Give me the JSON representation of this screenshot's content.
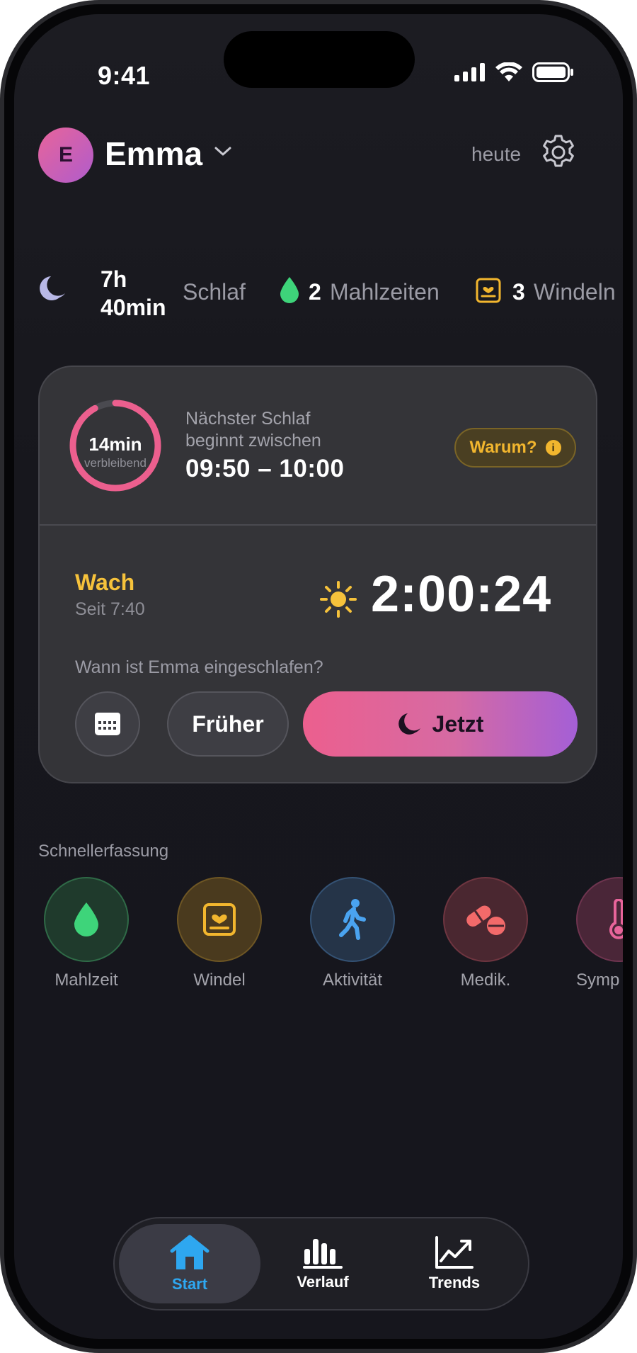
{
  "status_bar": {
    "time": "9:41"
  },
  "header": {
    "avatar_initial": "E",
    "profile_name": "Emma",
    "date_label": "heute"
  },
  "summary": {
    "sleep_value": "7h 40min",
    "sleep_label": "Schlaf",
    "meals_value": "2",
    "meals_label": "Mahlzeiten",
    "diapers_value": "3",
    "diapers_label": "Windeln"
  },
  "next_sleep": {
    "remaining_value": "14min",
    "remaining_label": "verbleibend",
    "remaining_fraction": 0.92,
    "label": "Nächster Schlaf beginnt zwischen",
    "range": "09:50 – 10:00",
    "why_label": "Warum?"
  },
  "awake": {
    "state": "Wach",
    "since": "Seit 7:40",
    "timer": "2:00:24",
    "question": "Wann ist Emma eingeschlafen?",
    "earlier_label": "Früher",
    "now_label": "Jetzt"
  },
  "quick_capture": {
    "title": "Schnellerfassung",
    "items": [
      {
        "label": "Mahlzeit",
        "icon": "drop-icon",
        "color": "#3ed47a"
      },
      {
        "label": "Windel",
        "icon": "diaper-icon",
        "color": "#f2b62e"
      },
      {
        "label": "Aktivität",
        "icon": "walking-icon",
        "color": "#4aa3f0"
      },
      {
        "label": "Medik.",
        "icon": "pills-icon",
        "color": "#f26a6a"
      },
      {
        "label": "Symp",
        "icon": "thermometer-icon",
        "color": "#e8649a"
      }
    ]
  },
  "tabbar": {
    "tabs": [
      {
        "label": "Start",
        "icon": "home-icon",
        "active": true
      },
      {
        "label": "Verlauf",
        "icon": "bar-chart-icon",
        "active": false
      },
      {
        "label": "Trends",
        "icon": "trend-line-icon",
        "active": false
      }
    ]
  },
  "colors": {
    "accent_pink": "#ec5f8e",
    "accent_purple": "#a45fd6",
    "awake_yellow": "#f6c23b",
    "active_tab_blue": "#2ea7f0"
  }
}
